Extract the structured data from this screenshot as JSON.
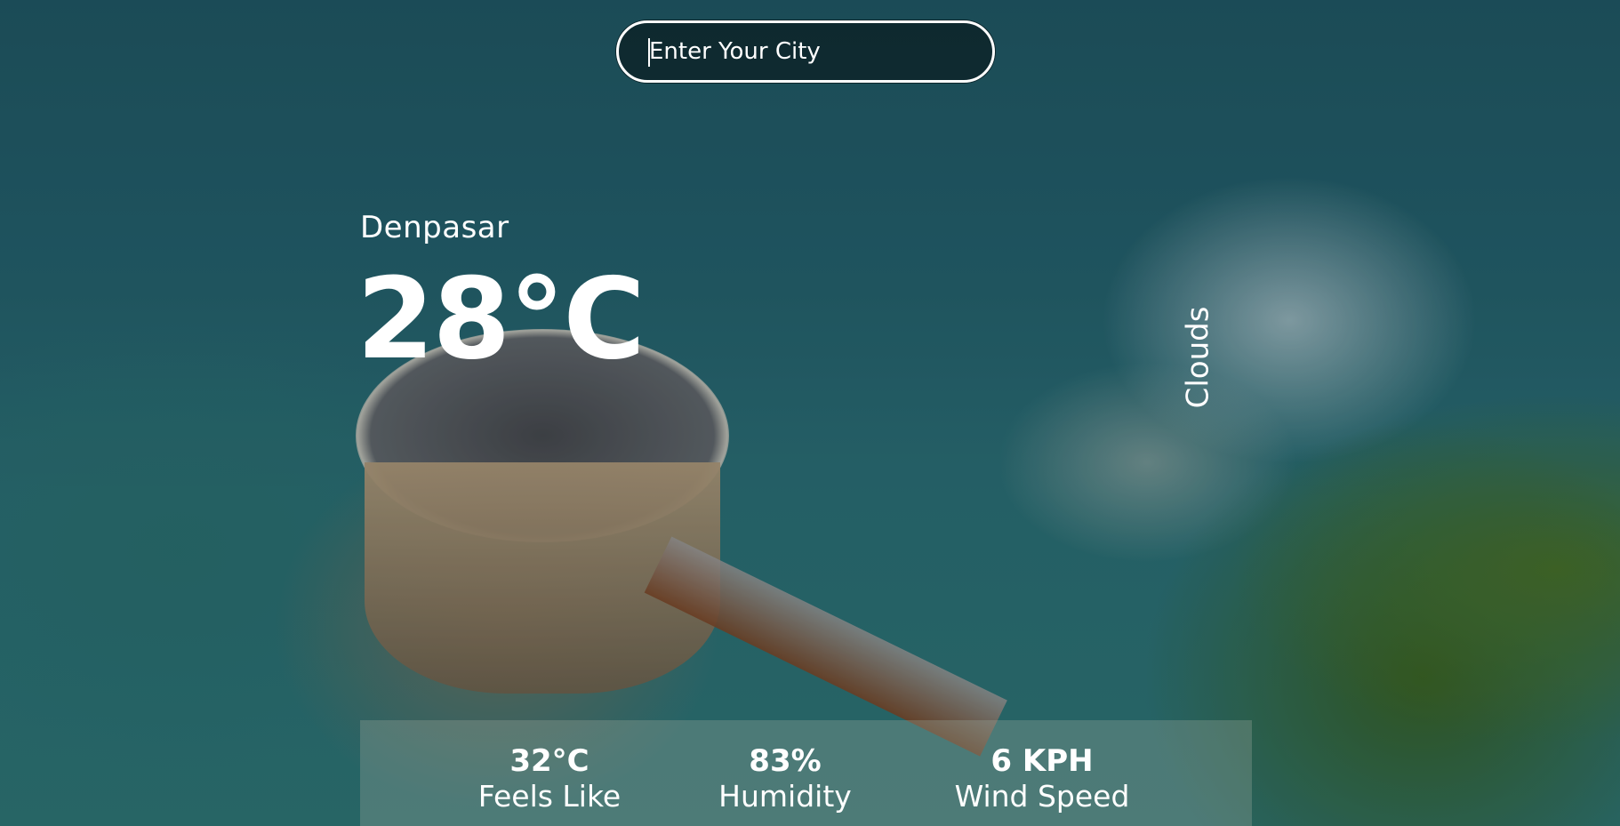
{
  "search": {
    "placeholder": "Enter Your City"
  },
  "weather": {
    "city": "Denpasar",
    "temperature": "28°C",
    "condition": "Clouds"
  },
  "details": {
    "feels_like": {
      "value": "32°C",
      "label": "Feels Like"
    },
    "humidity": {
      "value": "83%",
      "label": "Humidity"
    },
    "wind_speed": {
      "value": "6 KPH",
      "label": "Wind Speed"
    }
  },
  "colors": {
    "text": "#ffffff",
    "sea": "#24606c",
    "panel": "rgba(160,170,160,0.32)"
  }
}
